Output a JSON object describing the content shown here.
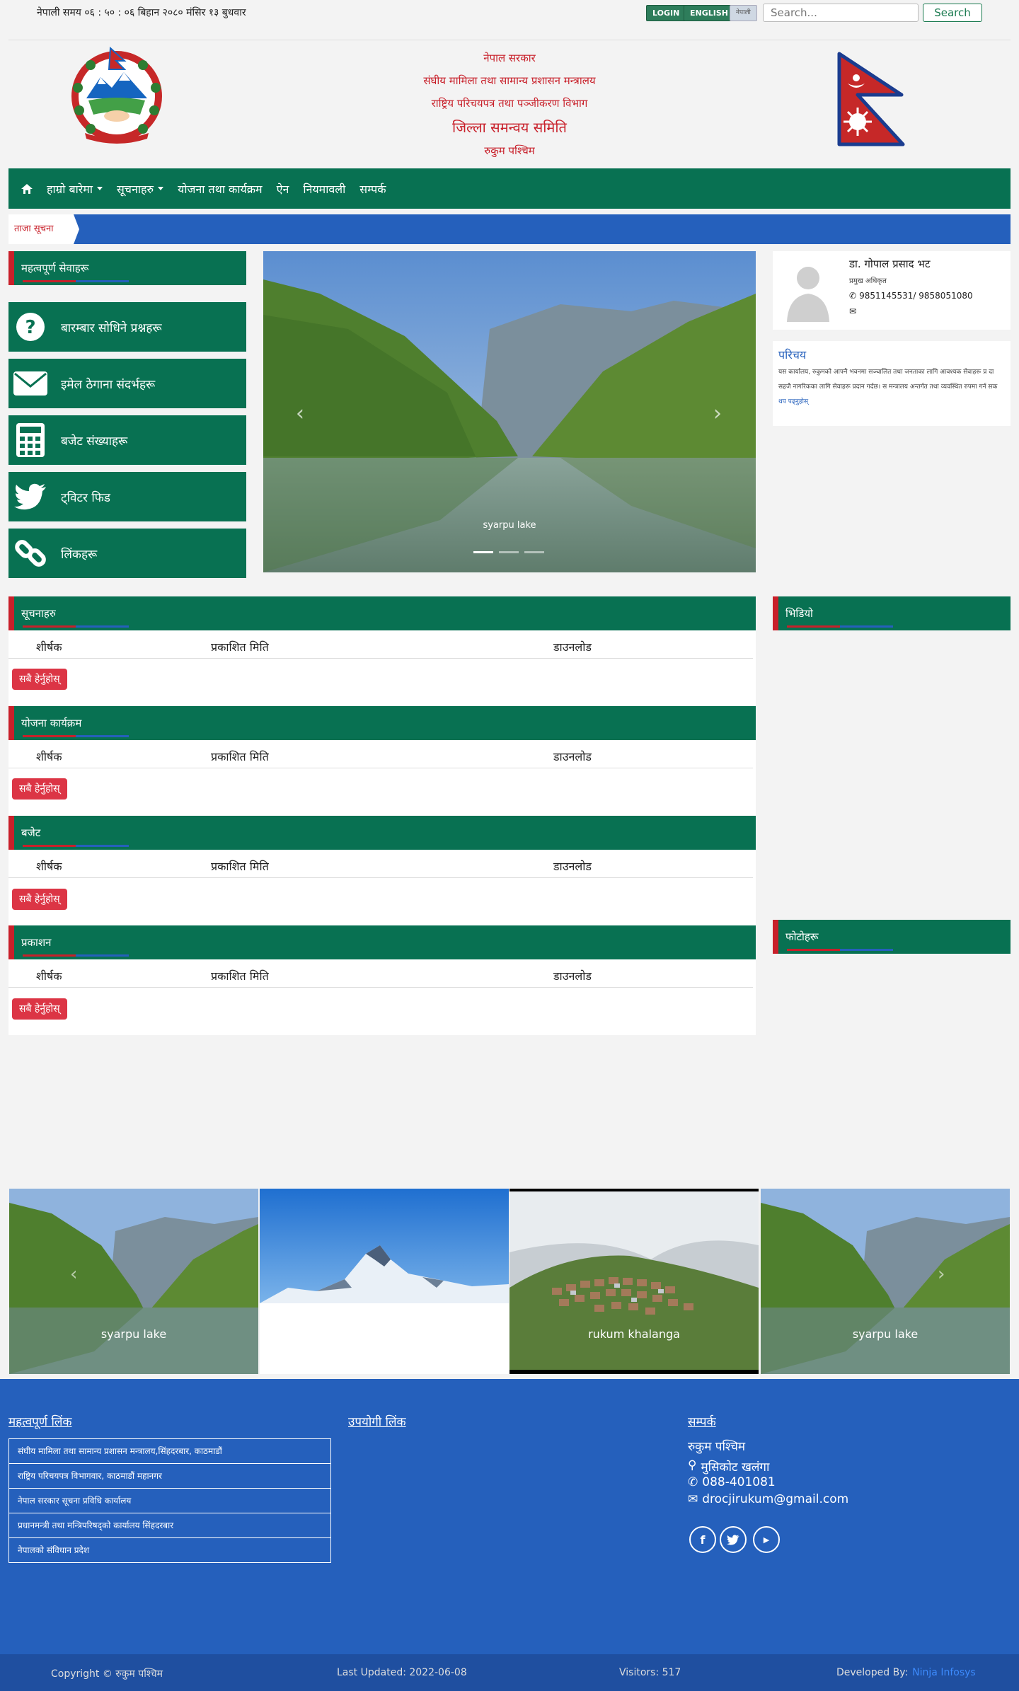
{
  "topbar": {
    "time_text": "नेपाली समय ०६ : ५० : ०६ बिहान   २०८० मंसिर १३ बुधवार",
    "login_label": "LOGIN",
    "english_label": "ENGLISH",
    "nepali_label": "नेपाली",
    "search_placeholder": "Search...",
    "search_button": "Search"
  },
  "header": {
    "lines": [
      "नेपाल सरकार",
      "संघीय मामिला तथा सामान्य प्रशासन मन्त्रालय",
      "राष्ट्रिय परिचयपत्र तथा पञ्जीकरण विभाग",
      "जिल्ला समन्वय समिति",
      "रुकुम पश्चिम"
    ]
  },
  "nav": {
    "items": [
      {
        "label": "हाम्रो बारेमा",
        "dropdown": true
      },
      {
        "label": "सूचनाहरु",
        "dropdown": true
      },
      {
        "label": "योजना तथा कार्यक्रम",
        "dropdown": false
      },
      {
        "label": "ऐन",
        "dropdown": false
      },
      {
        "label": "नियमावली",
        "dropdown": false
      },
      {
        "label": "सम्पर्क",
        "dropdown": false
      }
    ]
  },
  "ticker": {
    "label": "ताजा सूचना"
  },
  "sidebar": {
    "title": "महत्वपूर्ण सेवाहरू",
    "tiles": [
      {
        "label": "बारम्बार सोधिने प्रश्नहरू",
        "icon": "question-icon"
      },
      {
        "label": "इमेल ठेगाना संदर्भहरू",
        "icon": "envelope-icon"
      },
      {
        "label": "बजेट संख्याहरू",
        "icon": "calculator-icon"
      },
      {
        "label": "ट्विटर फिड",
        "icon": "twitter-icon"
      },
      {
        "label": "लिंकहरू",
        "icon": "link-icon"
      }
    ]
  },
  "slider": {
    "caption": "syarpu lake"
  },
  "officer": {
    "name": "डा. गोपाल प्रसाद भट",
    "designation": "प्रमुख अधिकृत",
    "phone": "9851145531/ 9858051080",
    "email": ""
  },
  "intro": {
    "title": "परिचय",
    "text": "यस कार्यालय, रुकुमको आफ्नै भवनमा सञ्चालित तथा जनताका लागि आवश्यक सेवाहरू प्र दा सहजै नागरिकका लागि सेवाहरू प्रदान गर्दछ। स मन्त्रालय अन्तर्गत तथा व्यवस्थित रुपमा गर्न सक",
    "more": "थप पढ्नुहोस्"
  },
  "table_columns": [
    "शीर्षक",
    "प्रकाशित मिति",
    "डाउनलोड"
  ],
  "sections": [
    {
      "title": "सूचनाहरु",
      "button": "सबै हेर्नुहोस्"
    },
    {
      "title": "योजना कार्यक्रम",
      "button": "सबै हेर्नुहोस्"
    },
    {
      "title": "बजेट",
      "button": "सबै हेर्नुहोस्"
    },
    {
      "title": "प्रकाशन",
      "button": "सबै हेर्नुहोस्"
    }
  ],
  "right_sections": [
    {
      "title": "भिडियो"
    },
    {
      "title": "फोटोहरू"
    }
  ],
  "gallery": {
    "captions": [
      "syarpu lake",
      "",
      "rukum khalanga",
      "syarpu lake"
    ]
  },
  "footer": {
    "col1_title": "महत्वपूर्ण लिंक",
    "links": [
      "संघीय मामिला तथा सामान्य प्रशासन मन्त्रालय,सिंहदरबार, काठमाडौं",
      "राष्ट्रिय परिचयपत्र विभागवार, काठमाडौं महानगर",
      "नेपाल सरकार सूचना प्रविधि कार्यालय",
      "प्रधानमन्त्री तथा मन्त्रिपरिषद्को कार्यालय सिंहदरबार",
      "नेपालको संविधान प्रदेश"
    ],
    "col2_title": "उपयोगी लिंक",
    "col3_title": "सम्पर्क",
    "org": "रुकुम पश्चिम",
    "address": "मुसिकोट खलंगा",
    "phone": "088-401081",
    "email": "drocjirukum@gmail.com"
  },
  "bottom": {
    "copyright": "Copyright © रुकुम पश्चिम",
    "updated": "Last Updated: 2022-06-08",
    "visitors": "Visitors: 517",
    "developed_prefix": "Developed By:",
    "developer": "Ninja Infosys"
  }
}
